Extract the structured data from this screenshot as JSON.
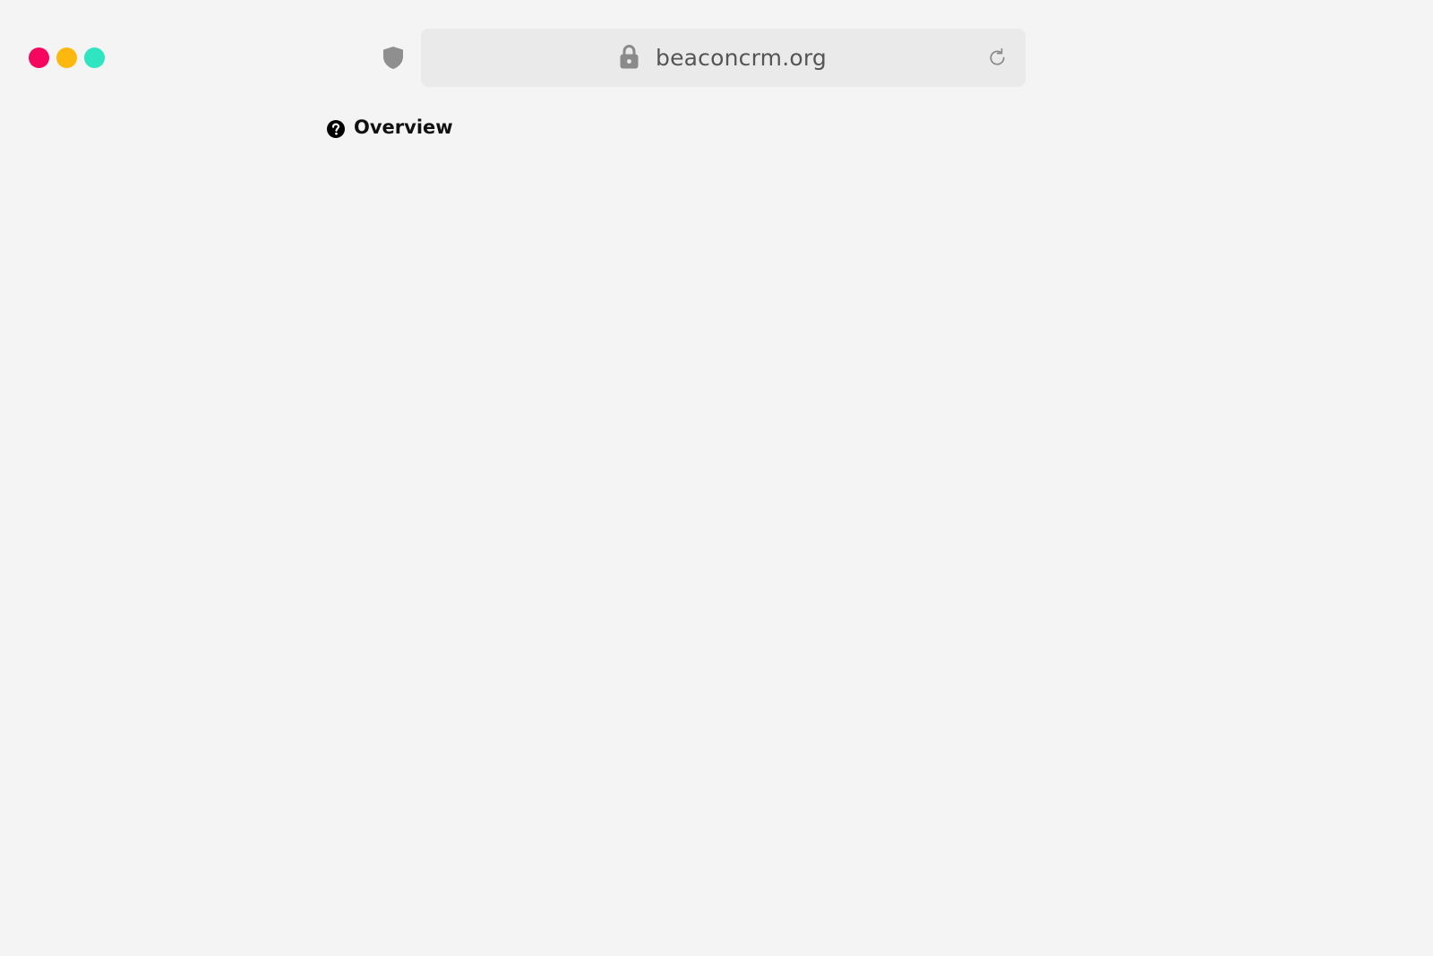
{
  "window_controls": {
    "colors": [
      "#f5065f",
      "#fdb80f",
      "#2de5c0"
    ]
  },
  "icons": {
    "shield": "shield-icon",
    "lock": "lock-icon",
    "reload": "reload-icon",
    "help": "help-circle-icon"
  },
  "address_bar": {
    "url": "beaconcrm.org"
  },
  "content": {
    "overview_label": "Overview"
  }
}
